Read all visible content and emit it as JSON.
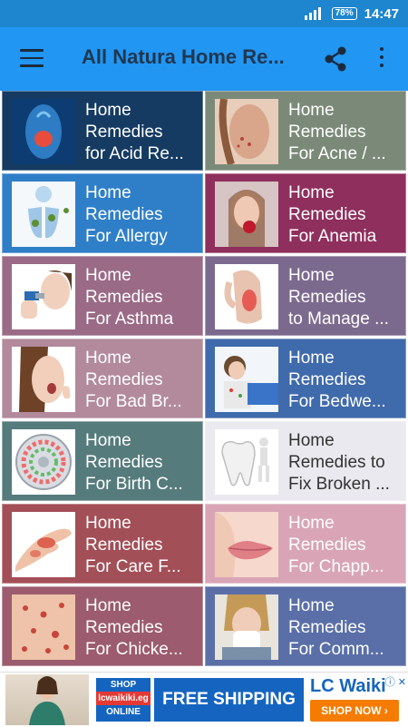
{
  "status_bar": {
    "battery": "78%",
    "time": "14:47"
  },
  "app_bar": {
    "title": "All Natura Home Re..."
  },
  "items": [
    {
      "lines": [
        "Home",
        "Remedies",
        "for Acid Re..."
      ],
      "bg": "#153b63",
      "icon": "digestive-system-icon"
    },
    {
      "lines": [
        "Home",
        "Remedies",
        "For Acne / ..."
      ],
      "bg": "#7b8a78",
      "icon": "acne-face-icon"
    },
    {
      "lines": [
        "Home",
        "Remedies",
        "For Allergy"
      ],
      "bg": "#2f7fc8",
      "icon": "lungs-icon"
    },
    {
      "lines": [
        "Home",
        "Remedies",
        "For Anemia"
      ],
      "bg": "#8f2f5d",
      "icon": "girl-rose-icon"
    },
    {
      "lines": [
        "Home",
        "Remedies",
        "For Asthma"
      ],
      "bg": "#9a6a86",
      "icon": "inhaler-icon"
    },
    {
      "lines": [
        "Home",
        "Remedies",
        "to Manage ..."
      ],
      "bg": "#7c6a8e",
      "icon": "back-pain-icon"
    },
    {
      "lines": [
        "Home",
        "Remedies",
        "For Bad Br..."
      ],
      "bg": "#b28a9c",
      "icon": "bad-breath-icon"
    },
    {
      "lines": [
        "Home",
        "Remedies",
        "For Bedwe..."
      ],
      "bg": "#3f6aab",
      "icon": "child-bed-icon"
    },
    {
      "lines": [
        "Home",
        "Remedies",
        "For Birth C..."
      ],
      "bg": "#567b7c",
      "icon": "pill-pack-icon"
    },
    {
      "lines": [
        "Home",
        "Remedies to",
        "Fix Broken ..."
      ],
      "bg": "#e9e9ef",
      "text_color": "#333333",
      "icon": "tooth-icon"
    },
    {
      "lines": [
        "Home",
        "Remedies",
        "For Care F..."
      ],
      "bg": "#a34f57",
      "icon": "burn-hand-icon"
    },
    {
      "lines": [
        "Home",
        "Remedies",
        "For Chapp..."
      ],
      "bg": "#d9a5b6",
      "icon": "lips-icon"
    },
    {
      "lines": [
        "Home",
        "Remedies",
        "For Chicke..."
      ],
      "bg": "#9c5b6e",
      "icon": "skin-rash-icon"
    },
    {
      "lines": [
        "Home",
        "Remedies",
        "For Comm..."
      ],
      "bg": "#5a6fa8",
      "icon": "sneeze-icon"
    }
  ],
  "ad": {
    "shop_top": "SHOP",
    "shop_mid": "lcwaikiki.eg",
    "shop_bottom": "ONLINE",
    "headline": "FREE SHIPPING",
    "brand": "LC Waiki",
    "cta": "SHOP NOW ›"
  }
}
